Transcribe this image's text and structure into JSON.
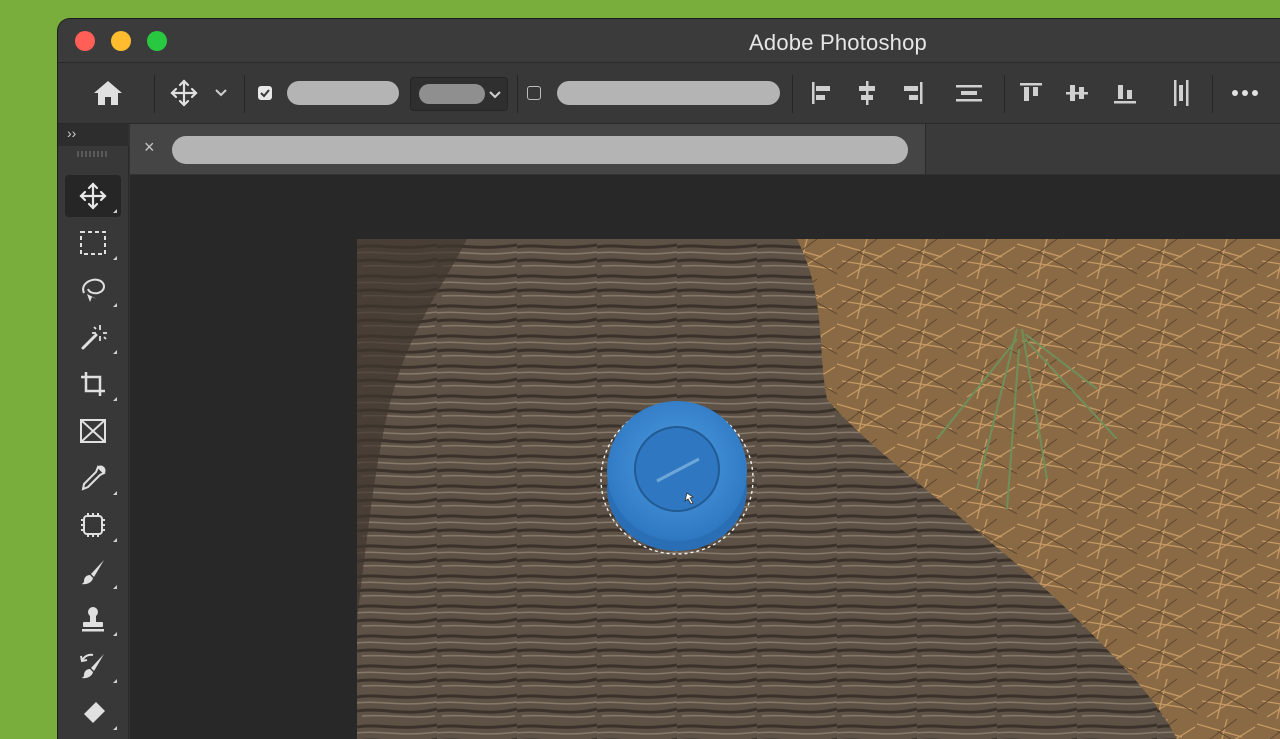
{
  "window": {
    "title": "Adobe Photoshop"
  },
  "titlebar": {
    "buttons": [
      "close",
      "minimize",
      "zoom"
    ]
  },
  "options_bar": {
    "icons": [
      "home-icon",
      "move-tool-icon",
      "chevron-down-icon",
      "align-left-icon",
      "align-center-horizontal-icon",
      "align-right-icon",
      "distribute-horizontal-icon",
      "align-top-icon",
      "align-middle-vertical-icon",
      "align-bottom-icon",
      "distribute-vertical-icon",
      "more-icon"
    ],
    "auto_select_checked": true,
    "transform_controls_checked": false
  },
  "panel": {
    "collapse_glyph": "››"
  },
  "document_tab": {
    "close_glyph": "×"
  },
  "tools": [
    {
      "name": "move-tool",
      "active": true
    },
    {
      "name": "rectangular-marquee-tool",
      "active": false
    },
    {
      "name": "lasso-tool",
      "active": false
    },
    {
      "name": "magic-wand-tool",
      "active": false
    },
    {
      "name": "crop-tool",
      "active": false
    },
    {
      "name": "frame-tool",
      "active": false
    },
    {
      "name": "eyedropper-tool",
      "active": false
    },
    {
      "name": "spot-healing-tool",
      "active": false
    },
    {
      "name": "brush-tool",
      "active": false
    },
    {
      "name": "clone-stamp-tool",
      "active": false
    },
    {
      "name": "history-brush-tool",
      "active": false
    },
    {
      "name": "eraser-tool",
      "active": false
    }
  ],
  "canvas": {
    "image": "photo of a blue compass on a tree log over pine needles",
    "selection": "marching ants around the compass"
  },
  "colors": {
    "desktop": "#7aae3c",
    "accent_compass": "#3d8fd6"
  }
}
